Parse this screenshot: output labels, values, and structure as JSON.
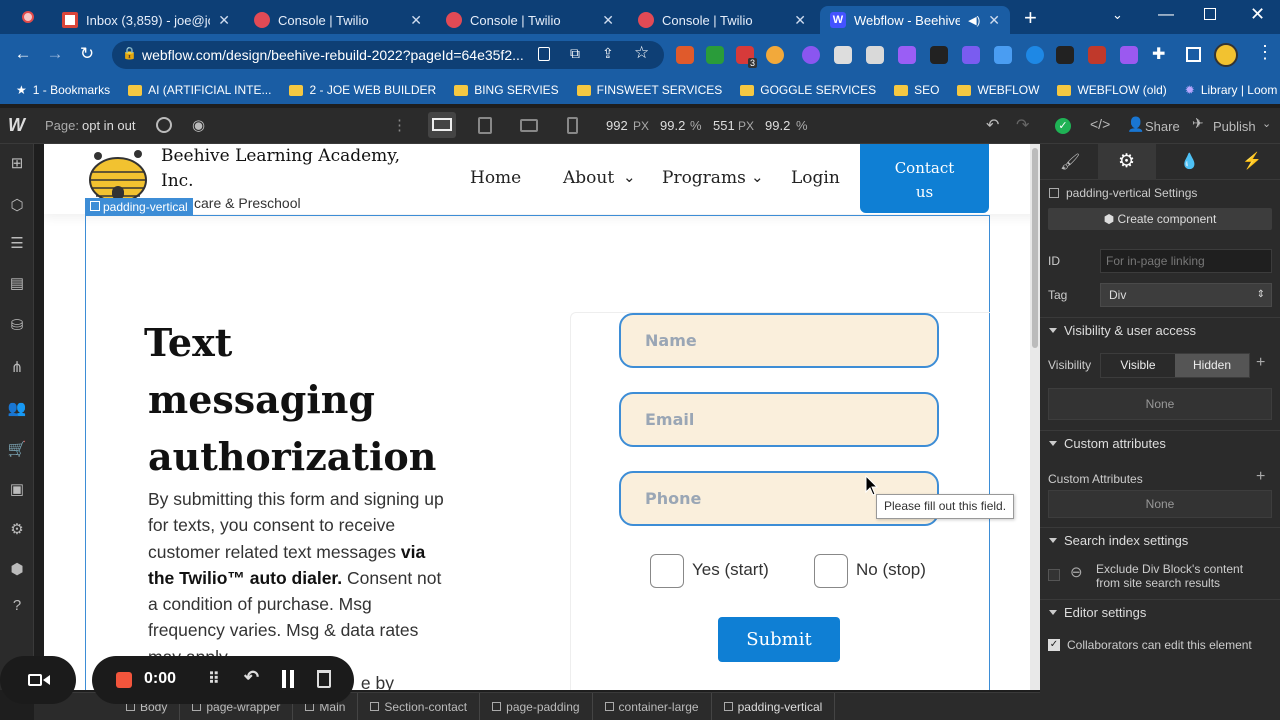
{
  "browser": {
    "tabs": [
      {
        "title": "Inbox (3,859) - joe@joe",
        "favicon": "gmail-icon"
      },
      {
        "title": "Console | Twilio",
        "favicon": "twilio-icon"
      },
      {
        "title": "Console | Twilio",
        "favicon": "twilio-icon"
      },
      {
        "title": "Console | Twilio",
        "favicon": "twilio-icon"
      },
      {
        "title": "Webflow - Beehive L",
        "favicon": "webflow-icon",
        "active": true
      }
    ],
    "url": "webflow.com/design/beehive-rebuild-2022?pageId=64e35f2...",
    "ext_badge": "3",
    "bookmarks": [
      "1 - Bookmarks",
      "AI (ARTIFICIAL INTE...",
      "2 - JOE WEB BUILDER",
      "BING SERVIES",
      "FINSWEET SERVICES",
      "GOGGLE SERVICES",
      "SEO",
      "WEBFLOW",
      "WEBFLOW (old)",
      "Library | Loom"
    ]
  },
  "designer": {
    "page_label": "Page:",
    "page_name": "opt in out",
    "width": "992",
    "width_unit": "PX",
    "zoom": "99.2",
    "zoom_unit": "%",
    "height": "551",
    "height_unit": "PX",
    "zoom2": "99.2",
    "zoom2_unit": "%",
    "share": "Share",
    "publish": "Publish",
    "selected_badge": "padding-vertical"
  },
  "site": {
    "brand_name_line1": "Beehive Learning Academy,",
    "brand_name_line2": "Inc.",
    "brand_tagline": "care & Preschool",
    "nav": {
      "home": "Home",
      "about": "About",
      "programs": "Programs",
      "login": "Login",
      "contact_line1": "Contact",
      "contact_line2": "us"
    },
    "heading_line1": "Text",
    "heading_line2": "messaging",
    "heading_line3": "authorization",
    "body_p1": "By submitting this form and signing up for texts, you consent to receive customer related text messages ",
    "body_bold": "via the Twilio™ auto dialer.",
    "body_p2": " Consent not a condition of purchase. Msg frequency varies. Msg & data rates may apply.",
    "body_tail": "e by",
    "form": {
      "name_ph": "Name",
      "email_ph": "Email",
      "phone_ph": "Phone",
      "yes_label": "Yes (start)",
      "no_label": "No (stop)",
      "submit": "Submit",
      "tooltip": "Please fill out this field."
    }
  },
  "panel": {
    "settings_title": "padding-vertical Settings",
    "create_component": "Create component",
    "id_label": "ID",
    "id_placeholder": "For in-page linking",
    "tag_label": "Tag",
    "tag_value": "Div",
    "visibility_section": "Visibility & user access",
    "visibility_label": "Visibility",
    "visible": "Visible",
    "hidden": "Hidden",
    "none1": "None",
    "custom_attr_section": "Custom attributes",
    "custom_attr_label": "Custom Attributes",
    "none2": "None",
    "search_section": "Search index settings",
    "exclude_line1": "Exclude Div Block's content",
    "exclude_line2": "from site search results",
    "editor_section": "Editor settings",
    "collaborators": "Collaborators can edit this element"
  },
  "breadcrumbs": [
    "Body",
    "page-wrapper",
    "Main",
    "Section-contact",
    "page-padding",
    "container-large",
    "padding-vertical"
  ],
  "recorder": {
    "time": "0:00"
  },
  "colors": {
    "accent": "#1a5da4",
    "site_blue": "#0f7fd4",
    "field_bg": "#faefdc"
  }
}
